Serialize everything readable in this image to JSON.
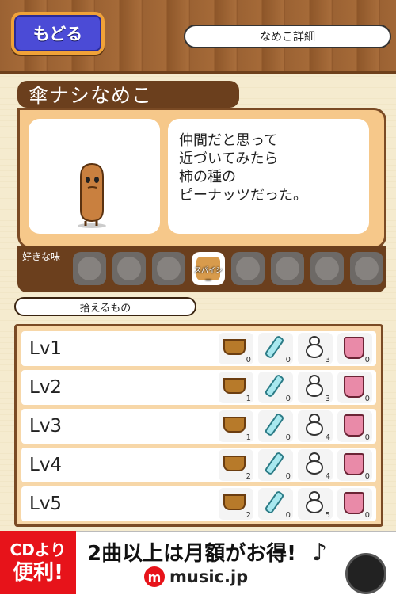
{
  "header": {
    "back_label": "もどる",
    "title": "なめこ詳細"
  },
  "nameko": {
    "name": "傘ナシなめこ",
    "description": "仲間だと思って\n近づいてみたら\n柿の種の\nピーナッツだった。"
  },
  "taste": {
    "label": "好きな味",
    "items": [
      {
        "icon": "locked-food-icon",
        "caption": "",
        "active": false
      },
      {
        "icon": "locked-food-icon",
        "caption": "",
        "active": false
      },
      {
        "icon": "locked-food-icon",
        "caption": "",
        "active": false
      },
      {
        "icon": "spicy-icon",
        "caption": "スパイシー",
        "active": true
      },
      {
        "icon": "locked-food-icon",
        "caption": "",
        "active": false
      },
      {
        "icon": "locked-food-icon",
        "caption": "",
        "active": false
      },
      {
        "icon": "locked-food-icon",
        "caption": "",
        "active": false
      },
      {
        "icon": "locked-food-icon",
        "caption": "",
        "active": false
      }
    ]
  },
  "pickups": {
    "label": "拾えるもの",
    "item_icons": [
      "basket-icon",
      "bottle-icon",
      "snowman-icon",
      "bucket-icon"
    ],
    "rows": [
      {
        "level": "Lv1",
        "counts": [
          "0",
          "0",
          "3",
          "0"
        ]
      },
      {
        "level": "Lv2",
        "counts": [
          "1",
          "0",
          "3",
          "0"
        ]
      },
      {
        "level": "Lv3",
        "counts": [
          "1",
          "0",
          "4",
          "0"
        ]
      },
      {
        "level": "Lv4",
        "counts": [
          "2",
          "0",
          "4",
          "0"
        ]
      },
      {
        "level": "Lv5",
        "counts": [
          "2",
          "0",
          "5",
          "0"
        ]
      }
    ]
  },
  "ad": {
    "badge_line1": "CDより",
    "badge_line2": "便利!",
    "headline": "2曲以上は月額がお得!",
    "logo_mark": "m",
    "brand": "music.jp",
    "note_icon": "♪"
  }
}
